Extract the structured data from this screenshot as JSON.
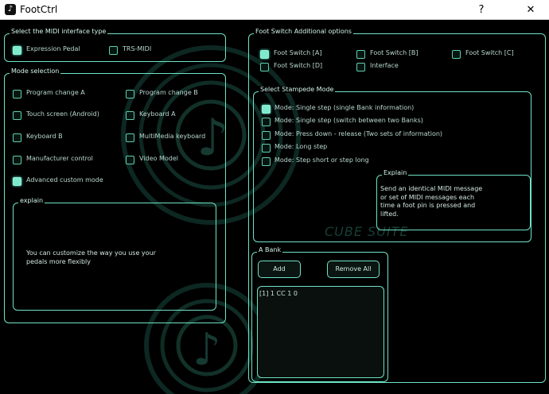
{
  "window": {
    "title": "FootCtrl",
    "help_label": "?",
    "close_label": "✕"
  },
  "watermark": "CUBE SUITE",
  "midi_interface": {
    "title": "Select the MIDI interface type",
    "options": [
      {
        "label": "Expression Pedal",
        "checked": true
      },
      {
        "label": "TRS-MIDI",
        "checked": false
      }
    ]
  },
  "mode_selection": {
    "title": "Mode selection",
    "options": [
      {
        "label": "Program change A",
        "checked": false
      },
      {
        "label": "Program change B",
        "checked": false
      },
      {
        "label": "Touch screen (Android)",
        "checked": false
      },
      {
        "label": "Keyboard A",
        "checked": false
      },
      {
        "label": "Keyboard B",
        "checked": false
      },
      {
        "label": "MultiMedia keyboard",
        "checked": false
      },
      {
        "label": "Manufacturer control",
        "checked": false
      },
      {
        "label": "Video Model",
        "checked": false
      },
      {
        "label": "Advanced custom mode",
        "checked": true
      }
    ],
    "explain": {
      "title": "explain",
      "text_lines": [
        "You can customize the way you use your",
        "pedals more flexibly"
      ]
    }
  },
  "foot_switch": {
    "title": "Foot Switch Additional options",
    "options": [
      {
        "label": "Foot Switch [A]",
        "checked": true
      },
      {
        "label": "Foot Switch [B]",
        "checked": false
      },
      {
        "label": "Foot Switch [C]",
        "checked": false
      },
      {
        "label": "Foot Switch [D]",
        "checked": false
      },
      {
        "label": "Interface",
        "checked": false
      }
    ]
  },
  "stampede": {
    "title": "Select Stampede Mode",
    "options": [
      {
        "label": "Mode: Single step (single Bank information)",
        "checked": true
      },
      {
        "label": "Mode: Single step (switch between two Banks)",
        "checked": false
      },
      {
        "label": "Mode: Press down - release (Two sets of information)",
        "checked": false
      },
      {
        "label": "Mode: Long step",
        "checked": false
      },
      {
        "label": "Mode:  Step short or step long",
        "checked": false
      }
    ],
    "explain": {
      "title": "Explain",
      "text_lines": [
        "Send an identical MIDI message",
        "or set of MIDI messages each",
        "time a foot pin is pressed and",
        "lifted."
      ]
    }
  },
  "bank": {
    "title": "A Bank",
    "add_label": "Add",
    "remove_label": "Remove All",
    "entries": [
      "[1]  1  CC  1  0"
    ]
  },
  "colors": {
    "accent": "#6fe3c6",
    "background": "#000000",
    "checked": "#7fe9cd"
  }
}
